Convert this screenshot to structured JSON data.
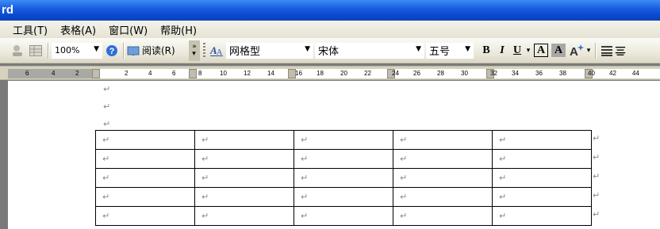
{
  "window": {
    "title": "rd"
  },
  "menu": [
    {
      "label": "工具(T)"
    },
    {
      "label": "表格(A)"
    },
    {
      "label": "窗口(W)"
    },
    {
      "label": "帮助(H)"
    }
  ],
  "toolbar": {
    "zoom": "100%",
    "read_label": "阅读(R)",
    "style_value": "网格型",
    "font_value": "宋体",
    "size_value": "五号",
    "bold": "B",
    "italic": "I",
    "underline": "U",
    "char_border": "A",
    "char_shading": "A"
  },
  "ruler": {
    "labels": [
      "6",
      "4",
      "2",
      "2",
      "4",
      "6",
      "8",
      "10",
      "12",
      "14",
      "16",
      "18",
      "20",
      "22",
      "24",
      "26",
      "28",
      "30",
      "32",
      "34",
      "36",
      "38",
      "40",
      "42",
      "44"
    ]
  },
  "document": {
    "para_mark": "↵",
    "table": {
      "rows": [
        [
          "↵",
          "↵",
          "↵",
          "↵",
          "↵"
        ],
        [
          "↵",
          "↵",
          "↵",
          "↵",
          "↵"
        ],
        [
          "↵",
          "↵",
          "↵",
          "↵",
          "↵"
        ],
        [
          "↵",
          "↵",
          "↵",
          "↵",
          "↵"
        ],
        [
          "↵",
          "↵",
          "↵",
          "↵",
          "↵"
        ]
      ]
    }
  }
}
